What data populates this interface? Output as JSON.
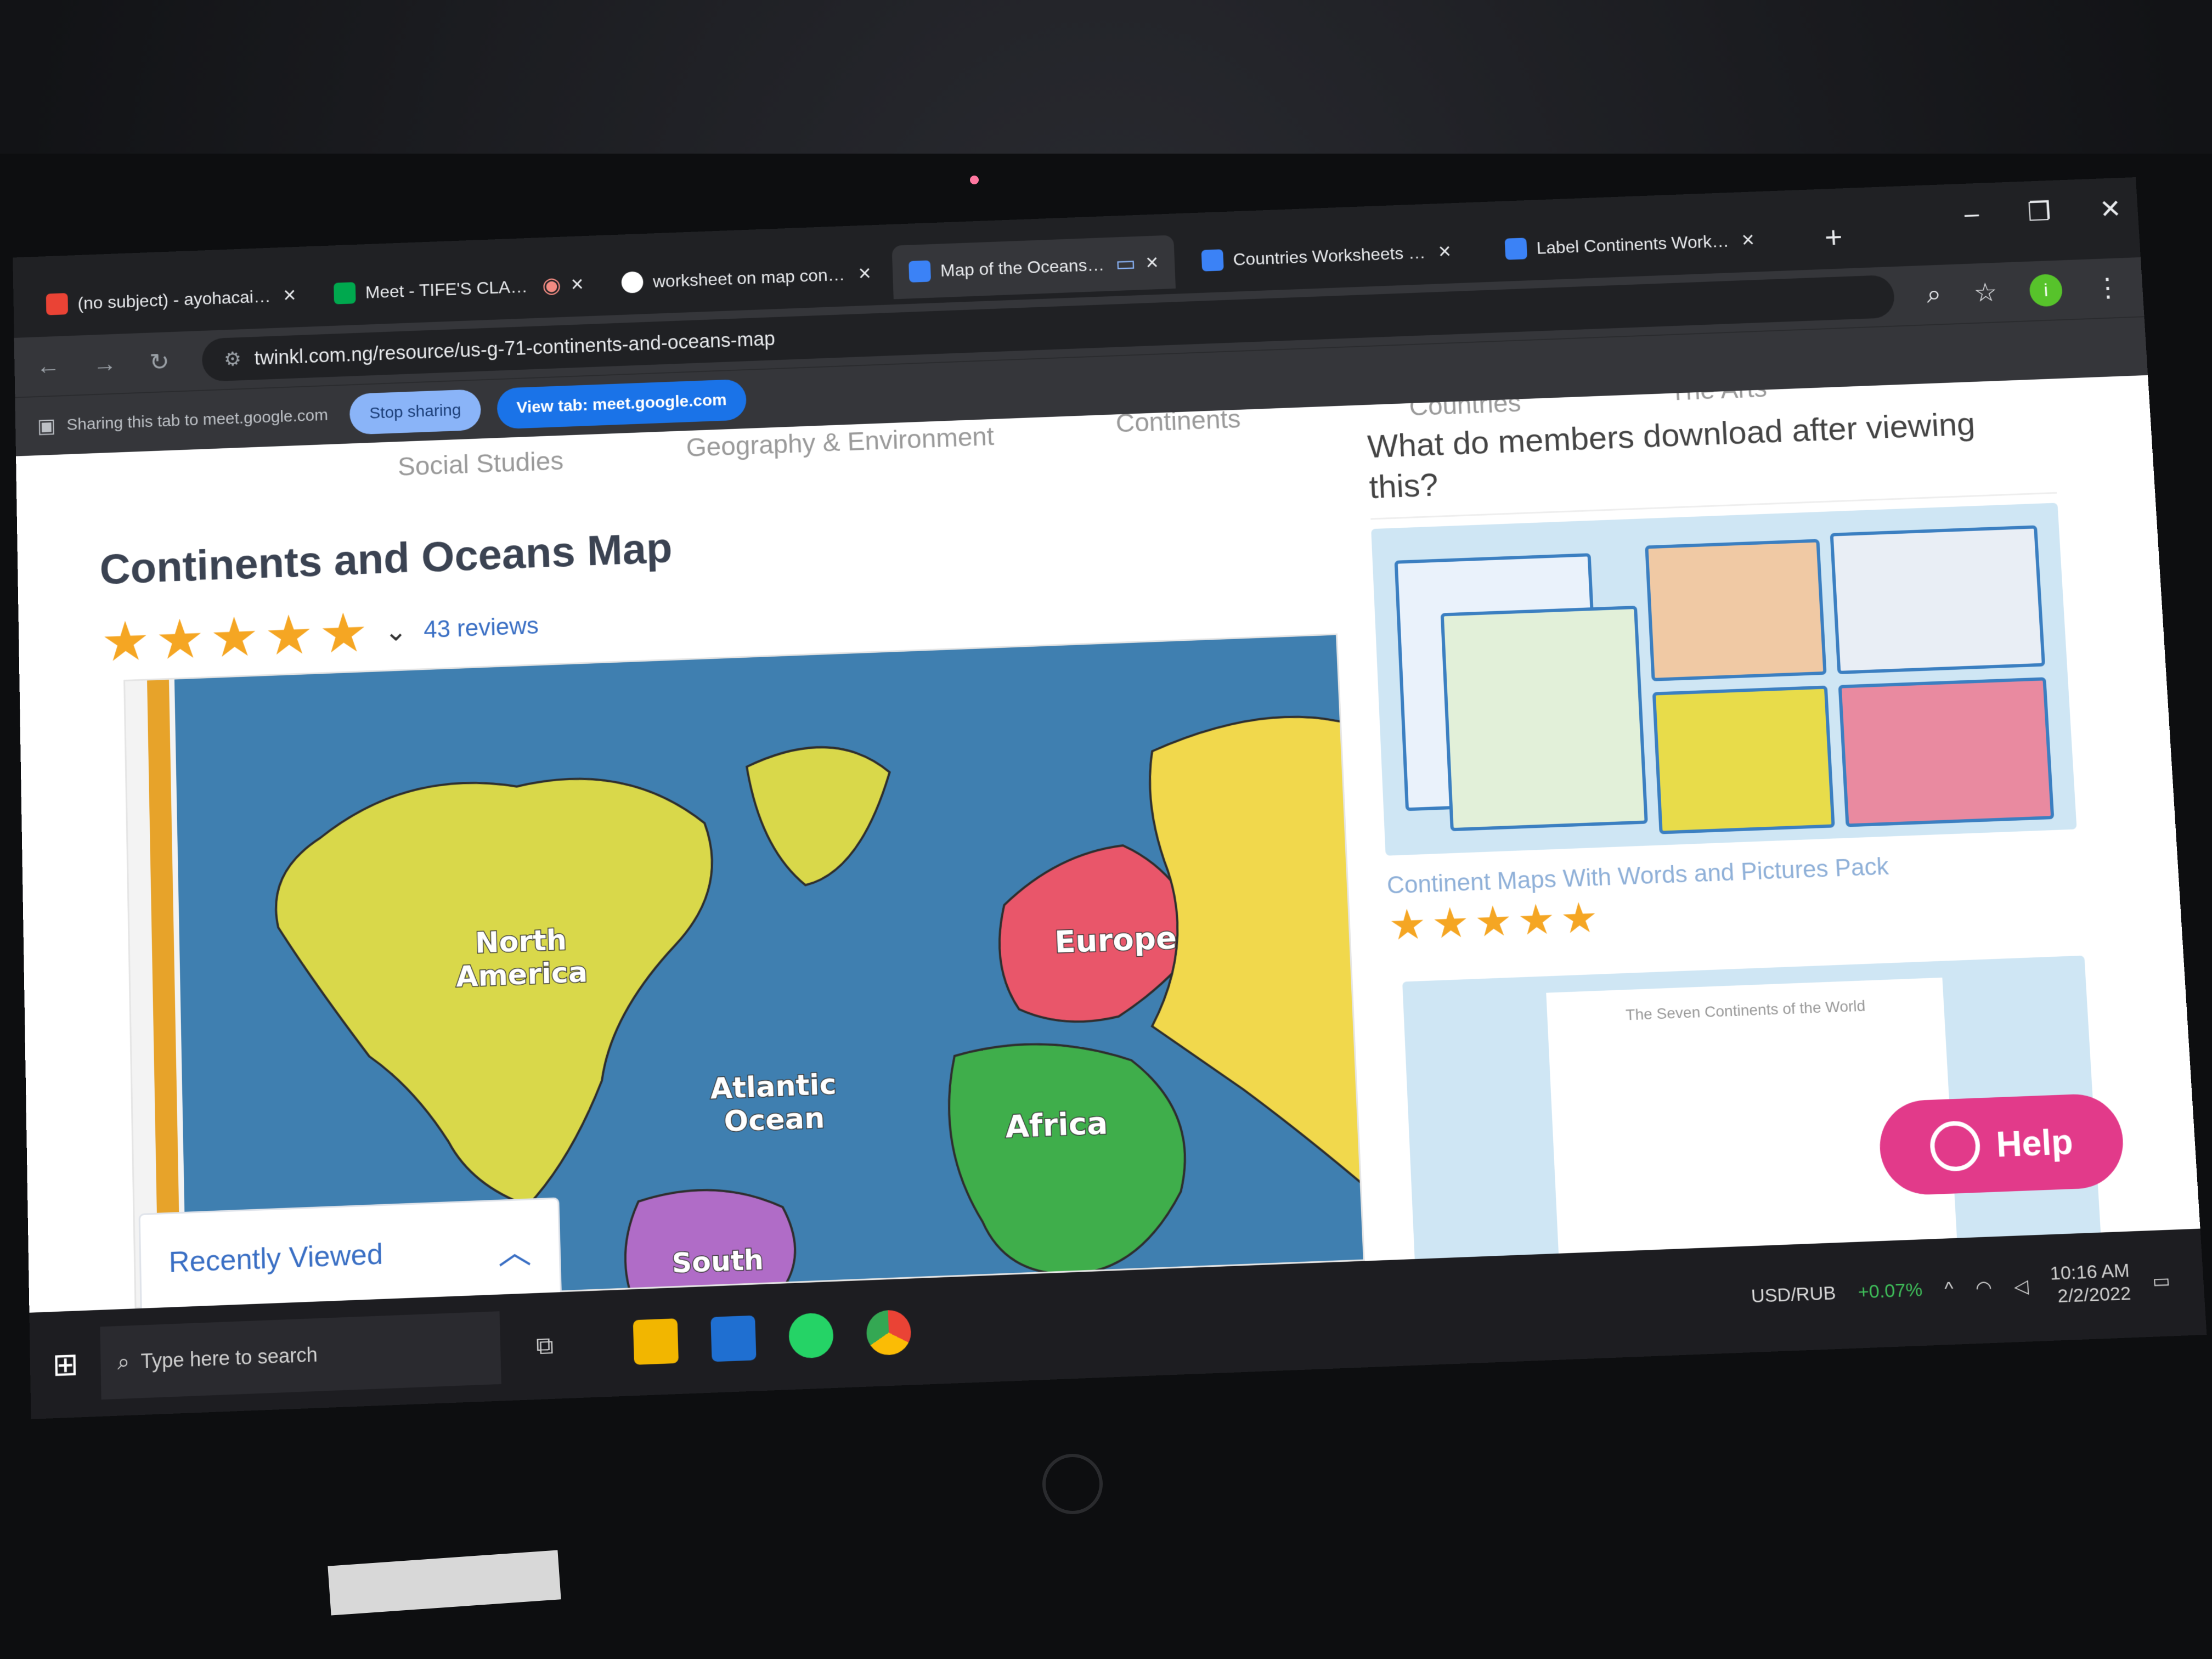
{
  "browser": {
    "tabs": [
      {
        "label": "(no subject) - ayohacaindo",
        "active": false,
        "icon": "gmail-icon",
        "color": "#ea4335"
      },
      {
        "label": "Meet - TIFE'S CLASS",
        "active": false,
        "icon": "meet-icon",
        "color": "#00a84e"
      },
      {
        "label": "worksheet on map continents",
        "active": false,
        "icon": "google-icon",
        "color": "#ffffff"
      },
      {
        "label": "Map of the Oceans and",
        "active": true,
        "icon": "twinkl-icon",
        "color": "#3b82f6"
      },
      {
        "label": "Countries Worksheets & Pr",
        "active": false,
        "icon": "twinkl-icon",
        "color": "#3b82f6"
      },
      {
        "label": "Label Continents Workshe",
        "active": false,
        "icon": "twinkl-icon",
        "color": "#3b82f6"
      }
    ],
    "new_tab": "+",
    "window_controls": {
      "minimize": "–",
      "restore": "❐",
      "close": "✕"
    },
    "url": "twinkl.com.ng/resource/us-g-71-continents-and-oceans-map",
    "profile_initial": "i"
  },
  "sharing": {
    "text": "Sharing this tab to meet.google.com",
    "stop": "Stop sharing",
    "view": "View tab: meet.google.com"
  },
  "page": {
    "subnav": [
      "Social Studies",
      "Geography & Environment",
      "Continents",
      "Countries",
      "The Arts"
    ],
    "title": "Continents and Oceans Map",
    "rating": 5,
    "reviews": "43 reviews",
    "map_labels": {
      "north_america": [
        "North",
        "America"
      ],
      "europe": "Europe",
      "atlantic": [
        "Atlantic",
        "Ocean"
      ],
      "africa": "Africa",
      "south": "South"
    },
    "recently_viewed": "Recently Viewed",
    "side_heading": "What do members download after viewing this?",
    "related_1": {
      "title": "Continent Maps With Words and Pictures Pack",
      "rating": 5
    },
    "related_2": {
      "sheet_title": "The Seven Continents of the World"
    },
    "help": "Help"
  },
  "taskbar": {
    "search_placeholder": "Type here to search",
    "ticker": "USD/RUB",
    "ticker_change": "+0.07%",
    "time": "10:16 AM",
    "date": "2/2/2022"
  },
  "colors": {
    "ocean": "#3f7fb0",
    "north_america": "#d9d84a",
    "europe": "#e9566a",
    "asia": "#f1d84c",
    "africa": "#3fae4b",
    "south_america": "#b06cc7",
    "accent_blue": "#3a6fc4",
    "star": "#f5a623",
    "help": "#e23a8a"
  }
}
